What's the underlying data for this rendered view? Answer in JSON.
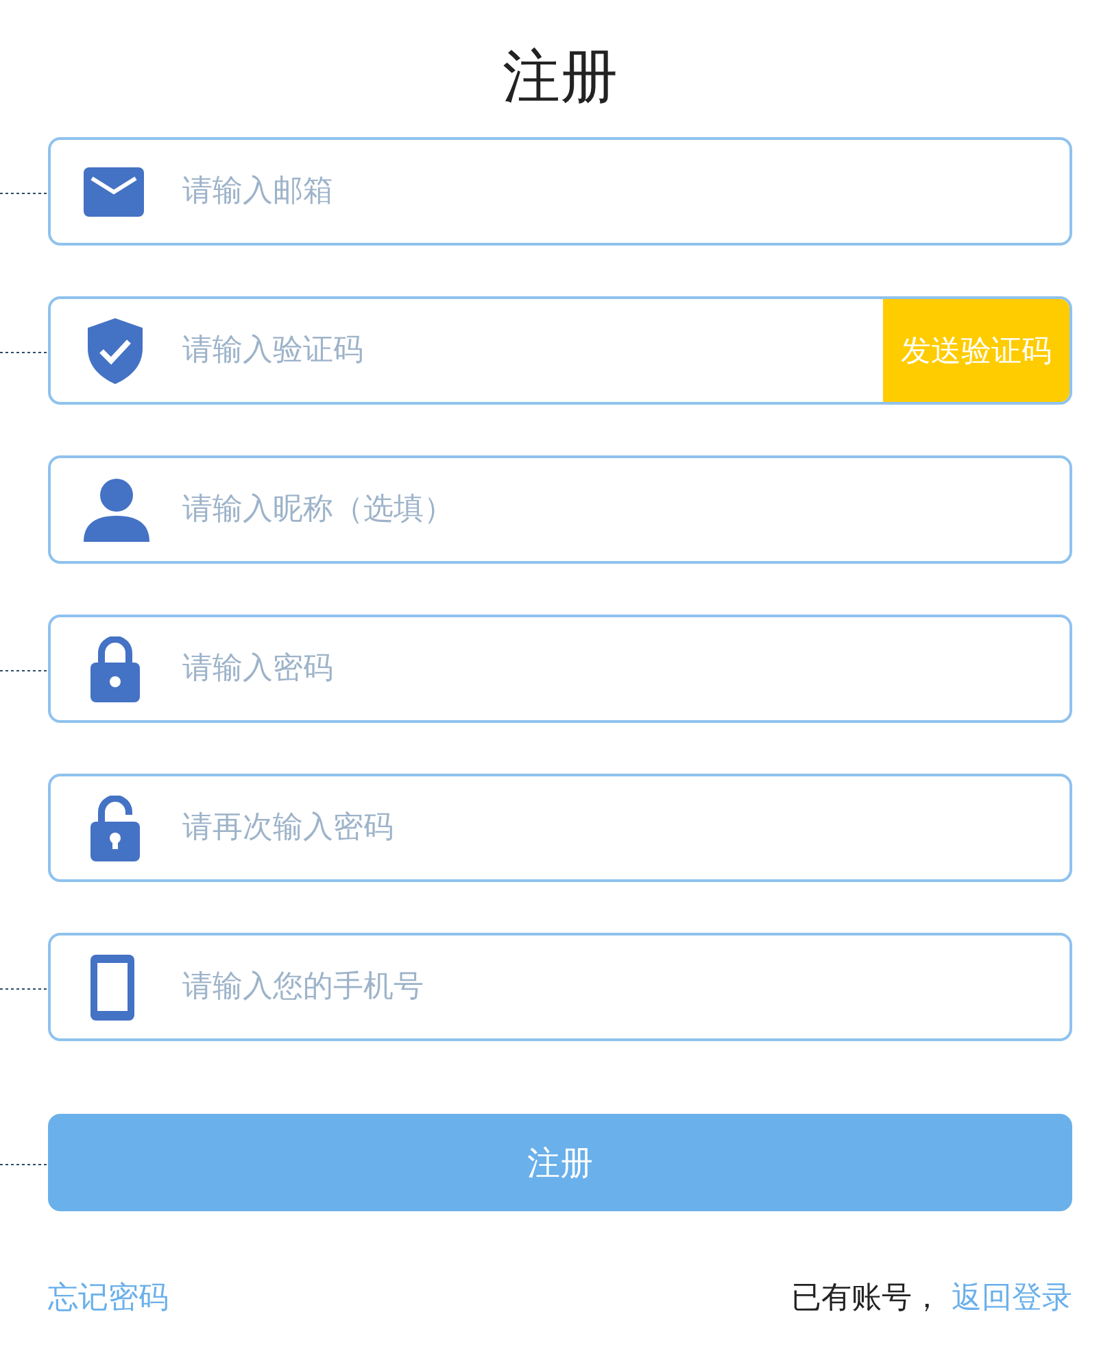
{
  "title": "注册",
  "fields": [
    {
      "kind": "mail",
      "placeholder": "请输入邮箱",
      "leader": true
    },
    {
      "kind": "shield",
      "placeholder": "请输入验证码",
      "leader": true,
      "action": "发送验证码"
    },
    {
      "kind": "user",
      "placeholder": "请输入昵称（选填）",
      "leader": false
    },
    {
      "kind": "lock",
      "placeholder": "请输入密码",
      "leader": true
    },
    {
      "kind": "unlock",
      "placeholder": "请再次输入密码",
      "leader": false
    },
    {
      "kind": "phone",
      "placeholder": "请输入您的手机号",
      "leader": true
    }
  ],
  "submit": {
    "label": "注册",
    "leader": true
  },
  "footer": {
    "forgot": "忘记密码",
    "prompt": "已有账号，",
    "login": "返回登录"
  }
}
